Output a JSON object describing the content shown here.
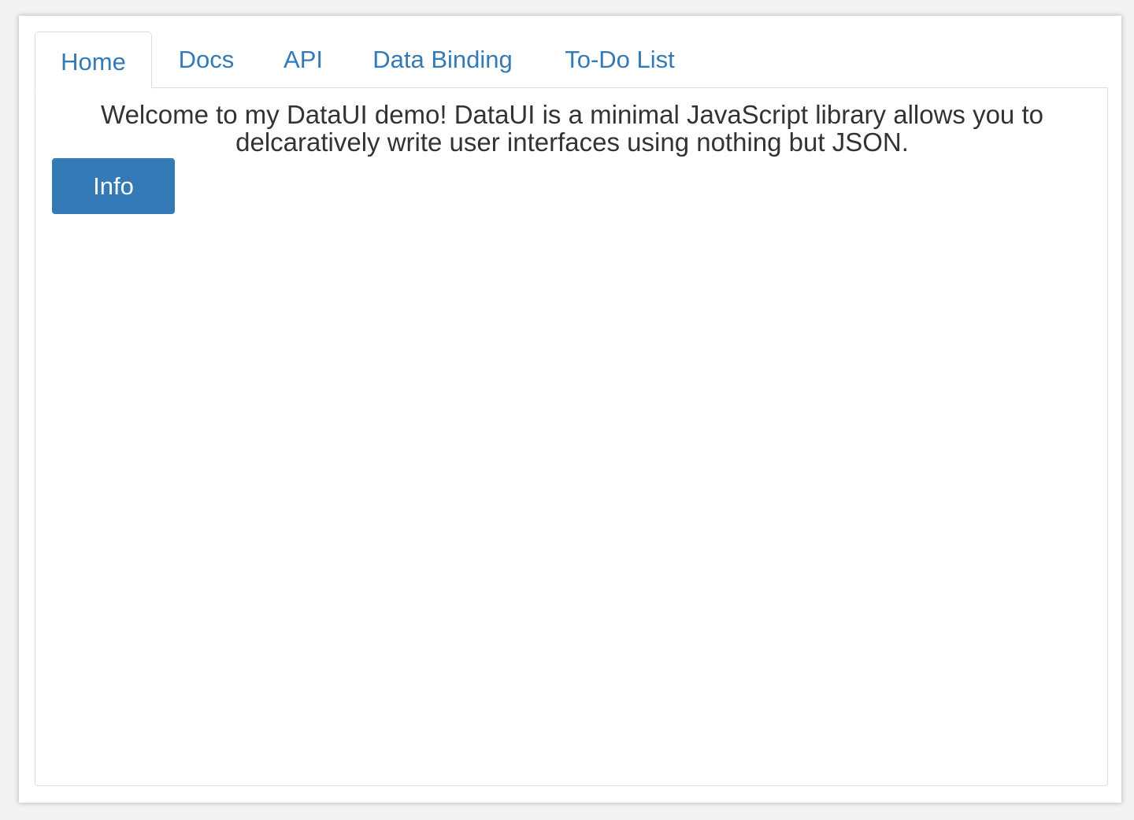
{
  "tabs": [
    {
      "label": "Home",
      "active": true
    },
    {
      "label": "Docs",
      "active": false
    },
    {
      "label": "API",
      "active": false
    },
    {
      "label": "Data Binding",
      "active": false
    },
    {
      "label": "To-Do List",
      "active": false
    }
  ],
  "home": {
    "welcome_text": "Welcome to my DataUI demo! DataUI is a minimal JavaScript library allows you to delcaratively write user interfaces using nothing but JSON.",
    "info_button_label": "Info"
  },
  "colors": {
    "accent": "#337ab7",
    "text": "#333333",
    "border": "#dddddd"
  }
}
